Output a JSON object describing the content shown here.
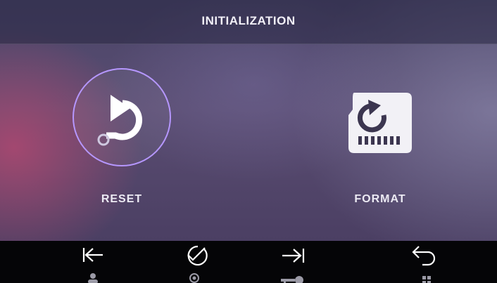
{
  "header": {
    "title": "INITIALIZATION"
  },
  "options": [
    {
      "id": "reset",
      "label": "RESET",
      "icon": "reset-icon",
      "selected": true
    },
    {
      "id": "format",
      "label": "FORMAT",
      "icon": "sd-card-format-icon",
      "selected": false
    }
  ],
  "bottom_bar": [
    {
      "icon": "arrow-left-to-line-icon",
      "sub_icon": "user-icon"
    },
    {
      "icon": "check-circle-icon",
      "sub_icon": "record-icon"
    },
    {
      "icon": "arrow-right-to-line-icon",
      "sub_icon": "key-icon"
    },
    {
      "icon": "return-arrow-icon",
      "sub_icon": "grid-icon"
    }
  ],
  "colors": {
    "selection_ring": "#b697ff",
    "text": "#eceaf3",
    "bottom_bar": "#050507"
  }
}
